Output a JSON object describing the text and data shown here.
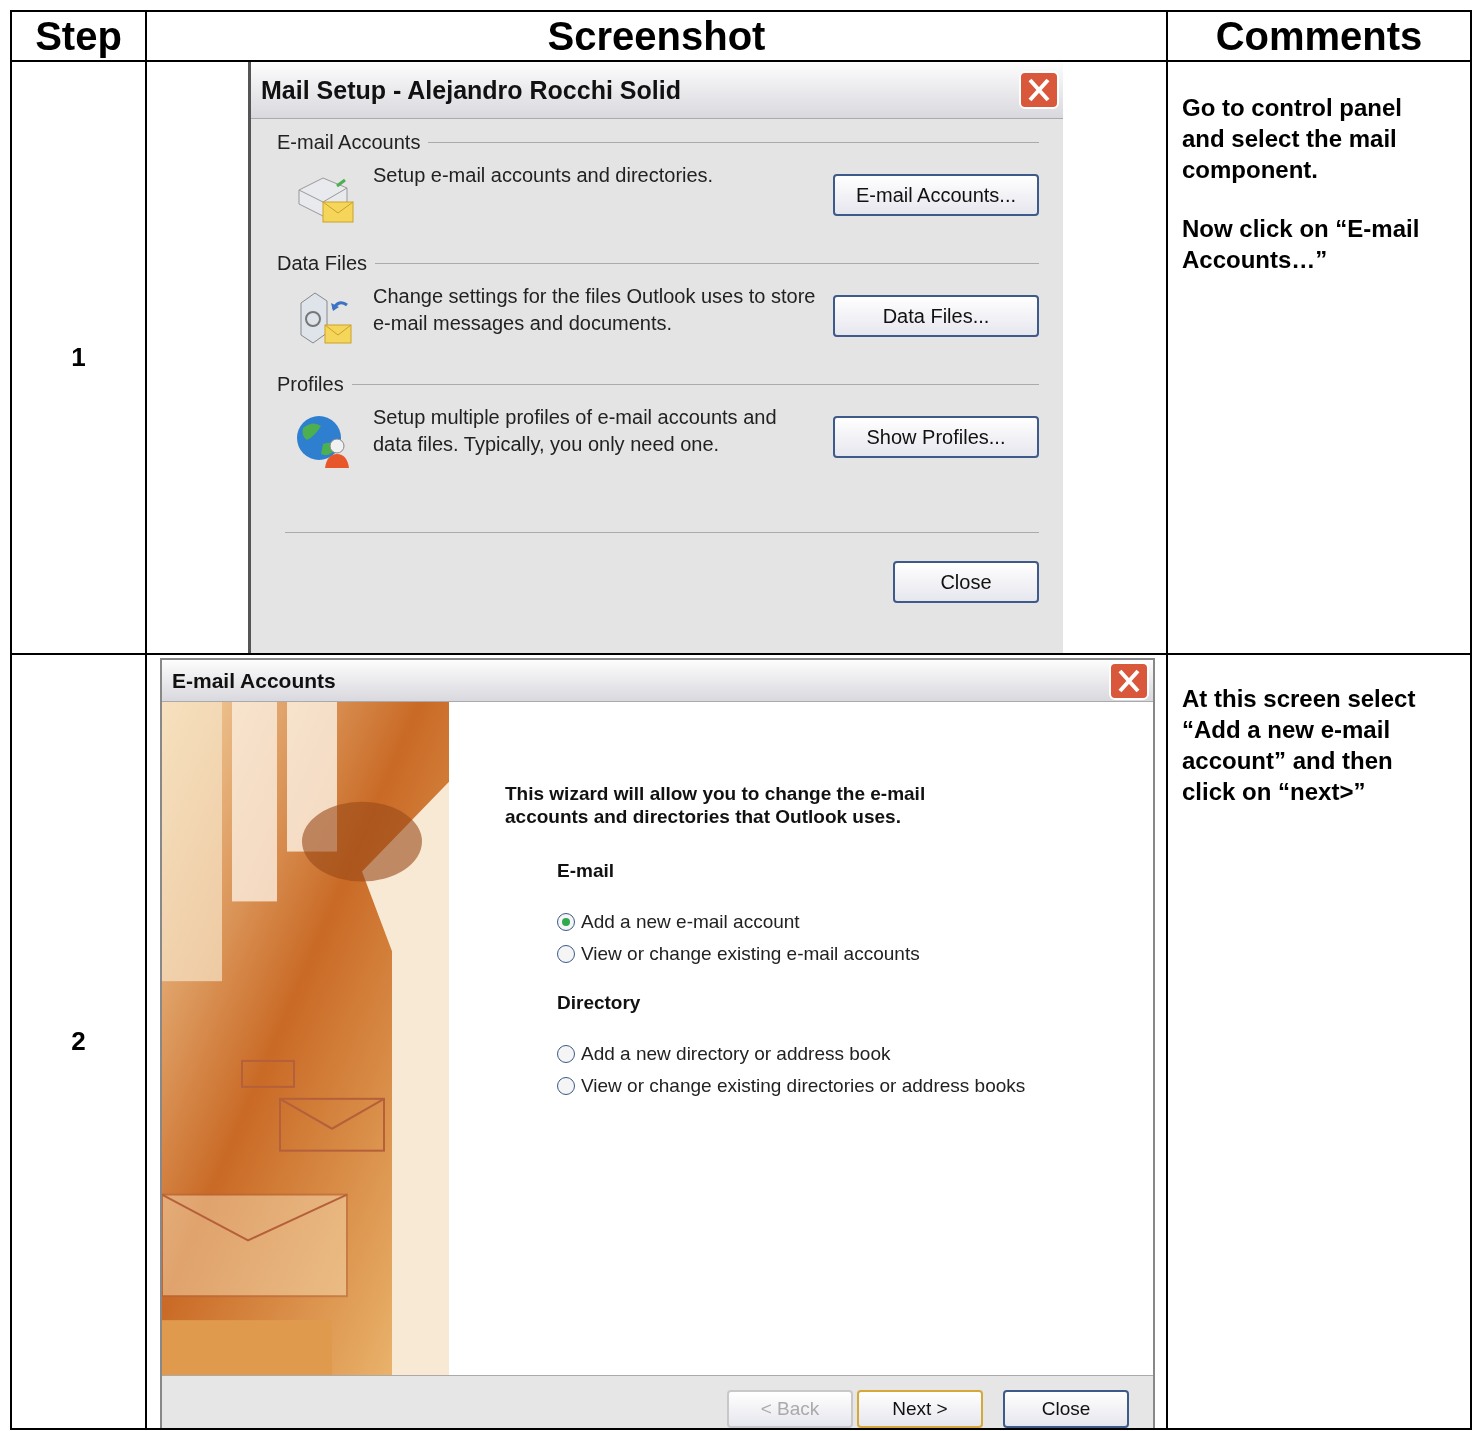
{
  "table": {
    "columns": [
      "Step",
      "Screenshot",
      "Comments"
    ],
    "rows": [
      {
        "step": "1",
        "screenshot": {
          "kind": "mail_setup",
          "title": "Mail Setup - Alejandro Rocchi Solid",
          "sections": [
            {
              "heading": "E-mail Accounts",
              "description": "Setup e-mail accounts and directories.",
              "button": "E-mail Accounts..."
            },
            {
              "heading": "Data Files",
              "description": "Change settings for the files Outlook uses to store e-mail messages and documents.",
              "button": "Data Files..."
            },
            {
              "heading": "Profiles",
              "description": "Setup multiple profiles of e-mail accounts and data files. Typically, you only need one.",
              "button": "Show Profiles..."
            }
          ],
          "footer_button": "Close"
        },
        "comments": [
          "Go to control panel and select the mail component.",
          "Now click on “E-mail Accounts…”"
        ]
      },
      {
        "step": "2",
        "screenshot": {
          "kind": "wizard",
          "title": "E-mail Accounts",
          "intro": "This wizard will allow you to change the e-mail accounts and directories that Outlook uses.",
          "groups": [
            {
              "heading": "E-mail",
              "options": [
                {
                  "label": "Add a new e-mail account",
                  "selected": true
                },
                {
                  "label": "View or change existing e-mail accounts",
                  "selected": false
                }
              ]
            },
            {
              "heading": "Directory",
              "options": [
                {
                  "label": "Add a new directory or address book",
                  "selected": false
                },
                {
                  "label": "View or change existing directories or address books",
                  "selected": false
                }
              ]
            }
          ],
          "buttons": [
            {
              "label": "< Back",
              "disabled": true,
              "default": false
            },
            {
              "label": "Next >",
              "disabled": false,
              "default": true
            },
            {
              "label": "Close",
              "disabled": false,
              "default": false
            }
          ]
        },
        "comments": [
          "At this screen select “Add a new e-mail account” and then click on “next>”"
        ]
      }
    ]
  }
}
